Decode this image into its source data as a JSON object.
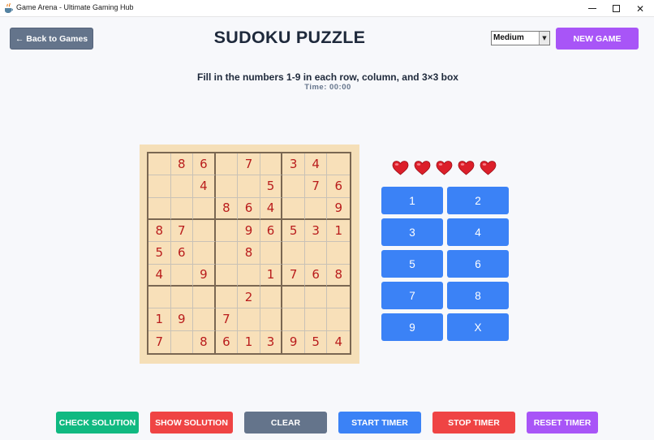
{
  "window": {
    "title": "Game Arena - Ultimate Gaming Hub",
    "icon": "java-cup-icon",
    "controls": [
      "minimize-icon",
      "maximize-icon",
      "close-icon"
    ],
    "close_glyph": "✕"
  },
  "header": {
    "back_label": "← Back to Games",
    "title": "SUDOKU PUZZLE",
    "difficulty": {
      "selected": "Medium",
      "arrow": "▼"
    },
    "new_game_label": "NEW GAME"
  },
  "instructions": "Fill in the numbers 1-9 in each row, column, and 3×3 box",
  "timer": "Time: 00:00",
  "board": [
    [
      "",
      "8",
      "6",
      "",
      "7",
      "",
      "3",
      "4",
      ""
    ],
    [
      "",
      "",
      "4",
      "",
      "",
      "5",
      "",
      "7",
      "6"
    ],
    [
      "",
      "",
      "",
      "8",
      "6",
      "4",
      "",
      "",
      "9"
    ],
    [
      "8",
      "7",
      "",
      "",
      "9",
      "6",
      "5",
      "3",
      "1"
    ],
    [
      "5",
      "6",
      "",
      "",
      "8",
      "",
      "",
      "",
      ""
    ],
    [
      "4",
      "",
      "9",
      "",
      "",
      "1",
      "7",
      "6",
      "8"
    ],
    [
      "",
      "",
      "",
      "",
      "2",
      "",
      "",
      "",
      ""
    ],
    [
      "1",
      "9",
      "",
      "7",
      "",
      "",
      "",
      "",
      ""
    ],
    [
      "7",
      "",
      "8",
      "6",
      "1",
      "3",
      "9",
      "5",
      "4"
    ]
  ],
  "lives": {
    "count": 5,
    "icon": "heart-icon"
  },
  "number_pad": [
    "1",
    "2",
    "3",
    "4",
    "5",
    "6",
    "7",
    "8",
    "9",
    "X"
  ],
  "actions": {
    "check": "CHECK SOLUTION",
    "show": "SHOW SOLUTION",
    "clear": "CLEAR",
    "start": "START TIMER",
    "stop": "STOP TIMER",
    "reset": "RESET TIMER"
  },
  "colors": {
    "board_bg": "#f8e0b9",
    "digit": "#b91c1c",
    "pad_button": "#3b82f6",
    "new_game": "#a855f7",
    "back_button": "#64748b",
    "check": "#10b981",
    "show": "#ef4444",
    "heart": "#dc1f2a"
  }
}
